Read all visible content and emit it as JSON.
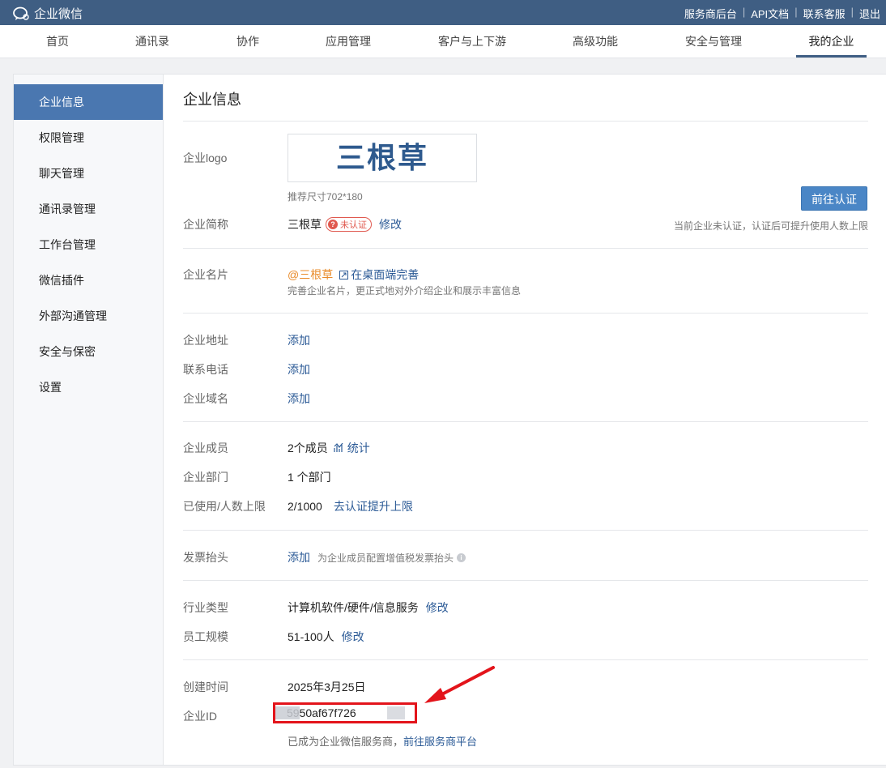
{
  "app": {
    "brand": "企业微信"
  },
  "toplinks": [
    "服务商后台",
    "API文档",
    "联系客服",
    "退出"
  ],
  "nav": {
    "tabs": [
      "首页",
      "通讯录",
      "协作",
      "应用管理",
      "客户与上下游",
      "高级功能",
      "安全与管理",
      "我的企业"
    ],
    "active": "我的企业"
  },
  "sidebar": {
    "items": [
      "企业信息",
      "权限管理",
      "聊天管理",
      "通讯录管理",
      "工作台管理",
      "微信插件",
      "外部沟通管理",
      "安全与保密",
      "设置"
    ],
    "active": "企业信息"
  },
  "page": {
    "title": "企业信息"
  },
  "logo": {
    "label": "企业logo",
    "text": "三根草",
    "size_hint": "推荐尺寸702*180"
  },
  "certify": {
    "button": "前往认证",
    "note": "当前企业未认证，认证后可提升使用人数上限"
  },
  "short_name": {
    "label": "企业简称",
    "value": "三根草",
    "badge": "未认证",
    "edit": "修改"
  },
  "card": {
    "label": "企业名片",
    "value": "@三根草",
    "action": "在桌面端完善",
    "desc": "完善企业名片，更正式地对外介绍企业和展示丰富信息"
  },
  "contact": {
    "address": {
      "label": "企业地址",
      "action": "添加"
    },
    "phone": {
      "label": "联系电话",
      "action": "添加"
    },
    "domain": {
      "label": "企业域名",
      "action": "添加"
    }
  },
  "stats": {
    "members": {
      "label": "企业成员",
      "value": "2个成员",
      "action": "统计"
    },
    "departments": {
      "label": "企业部门",
      "value": "1 个部门"
    },
    "limit": {
      "label": "已使用/人数上限",
      "value": "2/1000",
      "action": "去认证提升上限"
    }
  },
  "invoice": {
    "label": "发票抬头",
    "action": "添加",
    "desc": "为企业成员配置增值税发票抬头"
  },
  "industry": {
    "label": "行业类型",
    "value": "计算机软件/硬件/信息服务",
    "edit": "修改"
  },
  "scale": {
    "label": "员工规模",
    "value": "51-100人",
    "edit": "修改"
  },
  "created": {
    "label": "创建时间",
    "value": "2025年3月25日"
  },
  "corp_id": {
    "label": "企业ID",
    "value_visible": "5950af67f726"
  },
  "provider": {
    "text": "已成为企业微信服务商，",
    "link": "前往服务商平台"
  },
  "colors": {
    "topbar": "#3f5e83",
    "accent": "#4a77b0",
    "highlight": "#e3141b",
    "link": "#2b5a96"
  }
}
